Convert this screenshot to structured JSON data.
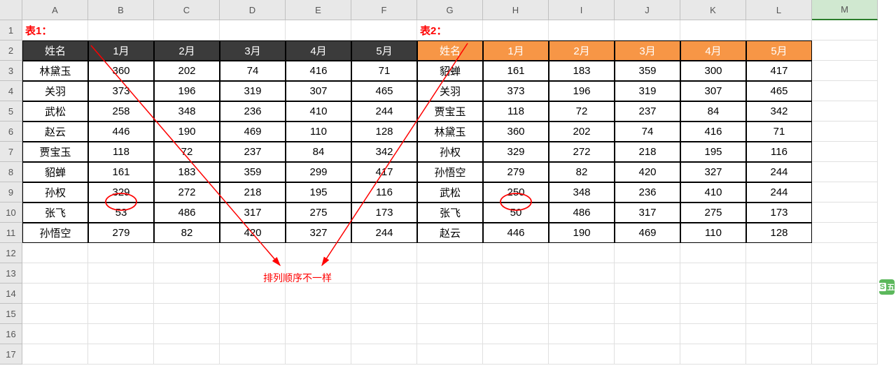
{
  "columns": [
    "A",
    "B",
    "C",
    "D",
    "E",
    "F",
    "G",
    "H",
    "I",
    "J",
    "K",
    "L",
    "M"
  ],
  "title1": "表1：",
  "title2": "表2：",
  "headers": [
    "姓名",
    "1月",
    "2月",
    "3月",
    "4月",
    "5月"
  ],
  "table1": [
    [
      "林黛玉",
      "360",
      "202",
      "74",
      "416",
      "71"
    ],
    [
      "关羽",
      "373",
      "196",
      "319",
      "307",
      "465"
    ],
    [
      "武松",
      "258",
      "348",
      "236",
      "410",
      "244"
    ],
    [
      "赵云",
      "446",
      "190",
      "469",
      "110",
      "128"
    ],
    [
      "贾宝玉",
      "118",
      "72",
      "237",
      "84",
      "342"
    ],
    [
      "貂蝉",
      "161",
      "183",
      "359",
      "299",
      "417"
    ],
    [
      "孙权",
      "329",
      "272",
      "218",
      "195",
      "116"
    ],
    [
      "张飞",
      "53",
      "486",
      "317",
      "275",
      "173"
    ],
    [
      "孙悟空",
      "279",
      "82",
      "420",
      "327",
      "244"
    ]
  ],
  "table2": [
    [
      "貂蝉",
      "161",
      "183",
      "359",
      "300",
      "417"
    ],
    [
      "关羽",
      "373",
      "196",
      "319",
      "307",
      "465"
    ],
    [
      "贾宝玉",
      "118",
      "72",
      "237",
      "84",
      "342"
    ],
    [
      "林黛玉",
      "360",
      "202",
      "74",
      "416",
      "71"
    ],
    [
      "孙权",
      "329",
      "272",
      "218",
      "195",
      "116"
    ],
    [
      "孙悟空",
      "279",
      "82",
      "420",
      "327",
      "244"
    ],
    [
      "武松",
      "250",
      "348",
      "236",
      "410",
      "244"
    ],
    [
      "张飞",
      "50",
      "486",
      "317",
      "275",
      "173"
    ],
    [
      "赵云",
      "446",
      "190",
      "469",
      "110",
      "128"
    ]
  ],
  "rows": 17,
  "annotation": "排列顺序不一样",
  "circled": {
    "t1": {
      "row": 10,
      "col": "B",
      "val": "53"
    },
    "t2": {
      "row": 10,
      "col": "H",
      "val": "50"
    }
  },
  "badge": "五"
}
